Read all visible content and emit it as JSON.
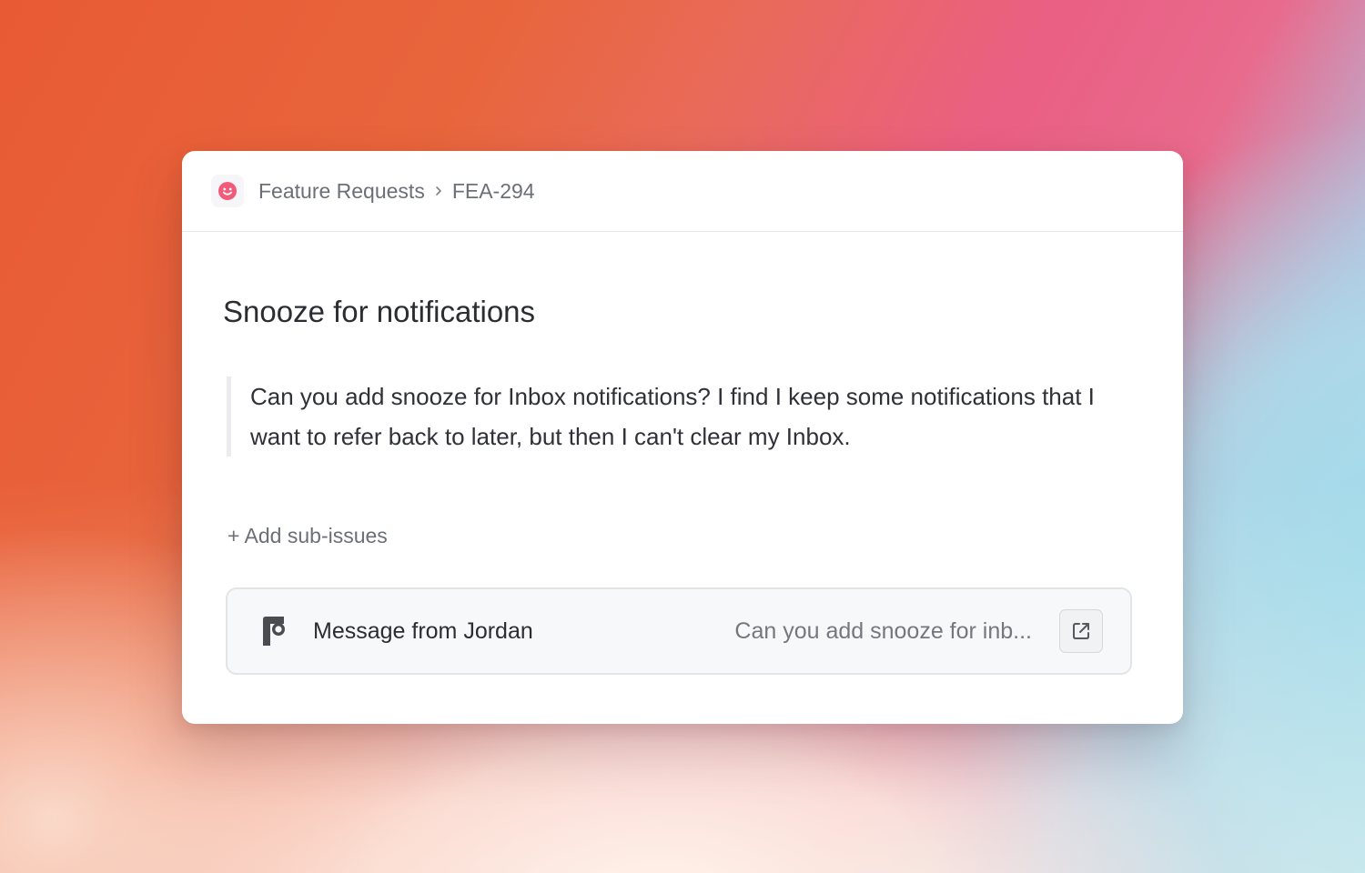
{
  "header": {
    "team_icon": "smiley-face-icon",
    "team_name": "Feature Requests",
    "separator_icon": "chevron-right-icon",
    "issue_id": "FEA-294"
  },
  "issue": {
    "title": "Snooze for notifications",
    "description": "Can you add snooze for Inbox notifications? I find I keep some notifications that I want to refer back to later, but then I can't clear my Inbox.",
    "add_sub_issues_label": "+ Add sub-issues"
  },
  "attachment": {
    "app_icon": "front-app-icon",
    "title": "Message from Jordan",
    "preview": "Can you add snooze for inb...",
    "open_icon": "external-link-icon"
  },
  "colors": {
    "team_icon": "#f25a7a",
    "text_primary": "#2b2d33",
    "text_secondary": "#6b6f76"
  }
}
